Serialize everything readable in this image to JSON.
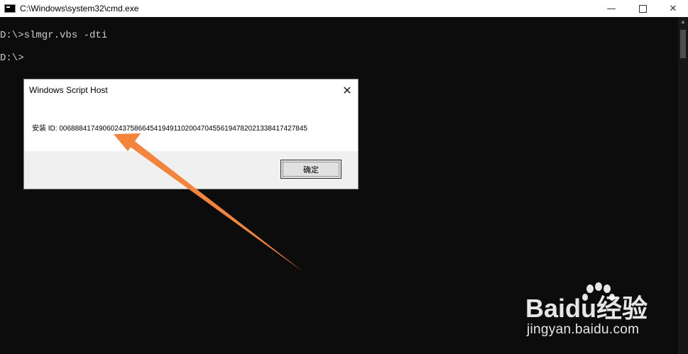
{
  "window": {
    "title": "C:\\Windows\\system32\\cmd.exe",
    "minimize_label": "—",
    "close_label": "✕"
  },
  "console": {
    "lines": [
      "D:\\>slmgr.vbs -dti",
      "D:\\>"
    ]
  },
  "dialog": {
    "title": "Windows Script Host",
    "close_label": "✕",
    "message": "安装 ID: 006888417490602437586645419491102004704556194782021338417427845",
    "ok_label": "确定"
  },
  "annotation": {
    "arrow_color": "#f4843c"
  },
  "watermark": {
    "brand": "Baidu经验",
    "url": "jingyan.baidu.com"
  },
  "colors": {
    "console_bg": "#0c0c0c",
    "console_text": "#cccccc",
    "dialog_footer": "#f0f0f0"
  }
}
